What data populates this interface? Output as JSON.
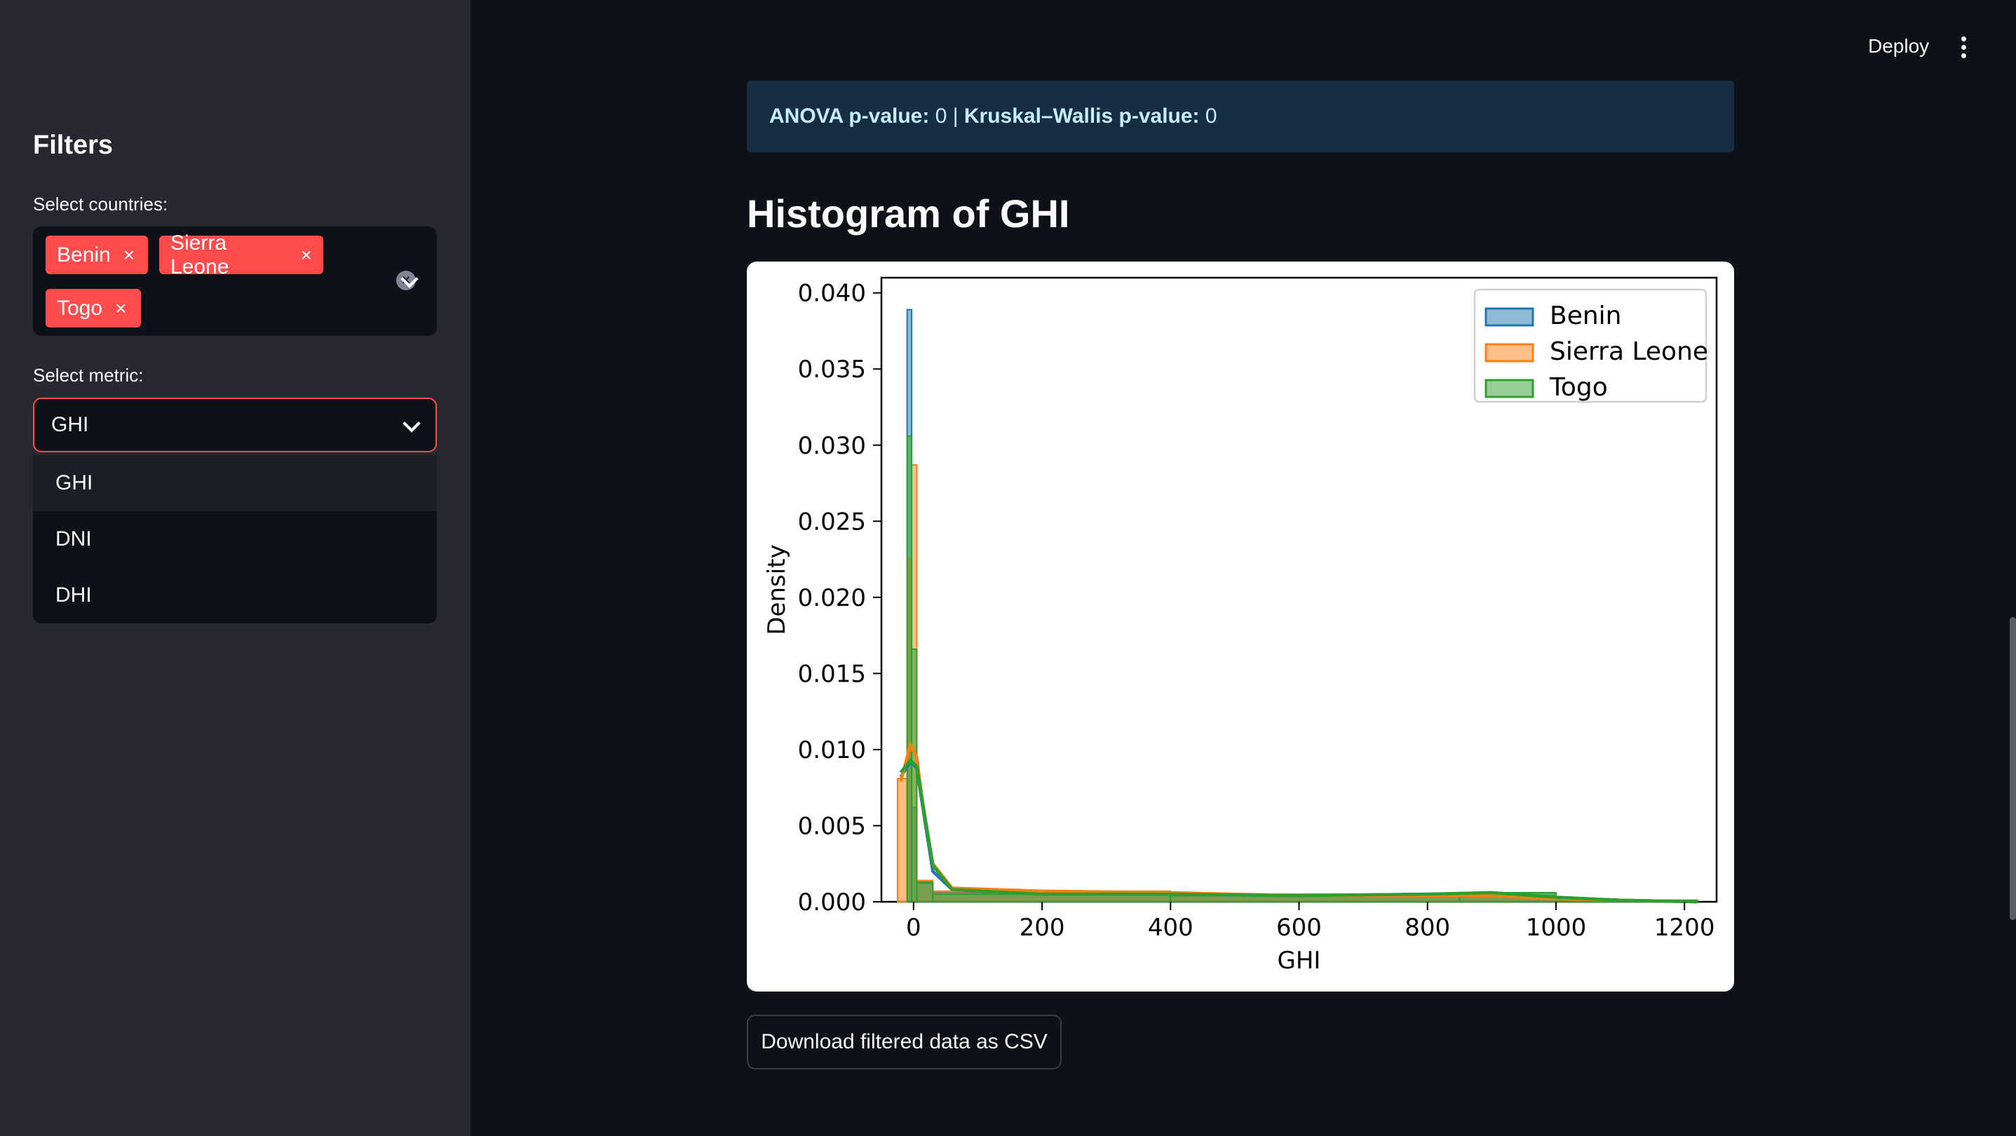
{
  "header": {
    "deploy_label": "Deploy",
    "menu_icon": "kebab-menu-icon"
  },
  "sidebar": {
    "title": "Filters",
    "countries_label": "Select countries:",
    "selected_countries": [
      "Benin",
      "Sierra Leone",
      "Togo"
    ],
    "remove_icon": "close-icon",
    "clear_icon": "clear-all-icon",
    "metric_label": "Select metric:",
    "metric_value": "GHI",
    "metric_options": [
      "GHI",
      "DNI",
      "DHI"
    ]
  },
  "main": {
    "stats": {
      "anova_label": "ANOVA p-value:",
      "anova_value": "0",
      "separator": "|",
      "kruskal_label": "Kruskal–Wallis p-value:",
      "kruskal_value": "0"
    },
    "section_title": "Histogram of GHI",
    "download_label": "Download filtered data as CSV"
  },
  "colors": {
    "accent": "#ff4b4b",
    "benin": "#1f77b4",
    "sierra_leone": "#ff7f0e",
    "togo": "#2ca02c"
  },
  "chart_data": {
    "type": "histogram",
    "xlabel": "GHI",
    "ylabel": "Density",
    "xlim": [
      -50,
      1250
    ],
    "ylim": [
      0,
      0.041
    ],
    "x_ticks": [
      0,
      200,
      400,
      600,
      800,
      1000,
      1200
    ],
    "y_ticks": [
      "0.000",
      "0.005",
      "0.010",
      "0.015",
      "0.020",
      "0.025",
      "0.030",
      "0.035",
      "0.040"
    ],
    "legend_position": "top-right",
    "series": [
      {
        "name": "Benin",
        "bins": [
          [
            -20,
            -10,
            0.0
          ],
          [
            -10,
            -3,
            0.0389
          ],
          [
            -3,
            5,
            0.0062
          ],
          [
            5,
            30,
            0.0012
          ],
          [
            30,
            400,
            0.0006
          ],
          [
            400,
            850,
            0.0005
          ],
          [
            850,
            1000,
            0.0006
          ],
          [
            1000,
            1220,
            0.0001
          ]
        ],
        "kde": [
          [
            -20,
            0.0082
          ],
          [
            -5,
            0.0092
          ],
          [
            5,
            0.0088
          ],
          [
            15,
            0.006
          ],
          [
            30,
            0.002
          ],
          [
            60,
            0.0008
          ],
          [
            200,
            0.0006
          ],
          [
            400,
            0.0005
          ],
          [
            600,
            0.0004
          ],
          [
            800,
            0.0005
          ],
          [
            900,
            0.0006
          ],
          [
            1000,
            0.0003
          ],
          [
            1100,
            0.0001
          ],
          [
            1220,
            0.0
          ]
        ]
      },
      {
        "name": "Sierra Leone",
        "bins": [
          [
            -25,
            -10,
            0.0081
          ],
          [
            -10,
            -3,
            0.0225
          ],
          [
            -3,
            5,
            0.0287
          ],
          [
            5,
            30,
            0.0014
          ],
          [
            30,
            400,
            0.0007
          ],
          [
            400,
            850,
            0.0005
          ],
          [
            850,
            1000,
            0.0004
          ],
          [
            1000,
            1220,
            0.0001
          ]
        ],
        "kde": [
          [
            -20,
            0.0079
          ],
          [
            -5,
            0.0103
          ],
          [
            5,
            0.0095
          ],
          [
            15,
            0.0062
          ],
          [
            30,
            0.0025
          ],
          [
            60,
            0.0009
          ],
          [
            200,
            0.0007
          ],
          [
            400,
            0.0006
          ],
          [
            600,
            0.0004
          ],
          [
            800,
            0.0004
          ],
          [
            900,
            0.0004
          ],
          [
            1000,
            0.0002
          ],
          [
            1100,
            0.0001
          ],
          [
            1220,
            0.0
          ]
        ]
      },
      {
        "name": "Togo",
        "bins": [
          [
            -20,
            -10,
            0.0
          ],
          [
            -10,
            -3,
            0.0306
          ],
          [
            -3,
            5,
            0.0166
          ],
          [
            5,
            30,
            0.0013
          ],
          [
            30,
            400,
            0.0005
          ],
          [
            400,
            850,
            0.0004
          ],
          [
            850,
            1000,
            0.0006
          ],
          [
            1000,
            1220,
            0.0001
          ]
        ],
        "kde": [
          [
            -20,
            0.0085
          ],
          [
            -5,
            0.0093
          ],
          [
            5,
            0.0089
          ],
          [
            15,
            0.0063
          ],
          [
            30,
            0.0024
          ],
          [
            60,
            0.0008
          ],
          [
            200,
            0.0005
          ],
          [
            400,
            0.0005
          ],
          [
            600,
            0.0004
          ],
          [
            800,
            0.0005
          ],
          [
            900,
            0.0006
          ],
          [
            1000,
            0.0003
          ],
          [
            1100,
            0.0001
          ],
          [
            1220,
            0.0
          ]
        ]
      }
    ]
  }
}
